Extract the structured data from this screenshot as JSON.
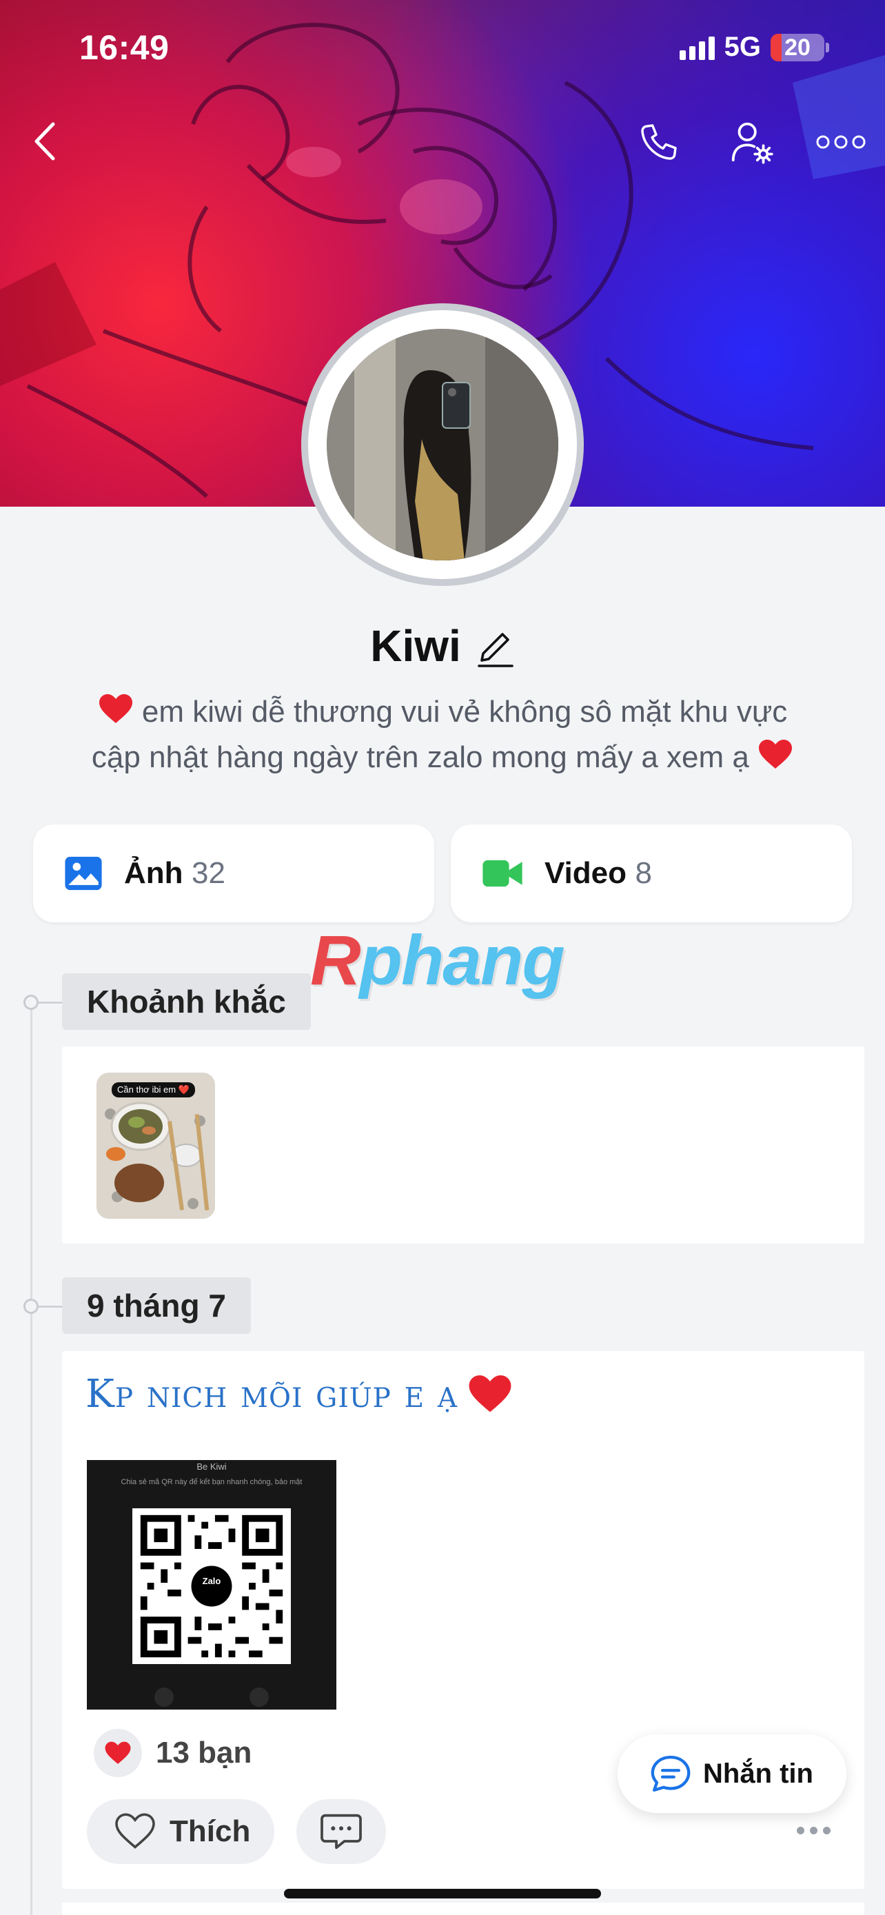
{
  "status_bar": {
    "time": "16:49",
    "network": "5G",
    "battery": "20",
    "battery_level_percent": 20
  },
  "nav": {
    "back_icon": "chevron-left-icon",
    "call_icon": "phone-icon",
    "settings_icon": "user-settings-icon",
    "more_icon": "more-horizontal-icon"
  },
  "profile": {
    "name": "Kiwi",
    "edit_icon": "pencil-icon",
    "bio_line1": "em kiwi dễ thương vui vẻ không sô mặt khu vực",
    "bio_line2": "cập nhật hàng ngày trên zalo mong mấy a xem ạ"
  },
  "media": {
    "photos_label": "Ảnh",
    "photos_count": "32",
    "videos_label": "Video",
    "videos_count": "8"
  },
  "watermark": {
    "r": "R",
    "rest": "phang"
  },
  "moments": {
    "label": "Khoảnh khắc",
    "thumb_caption": "Cần thơ ibi em ❤️"
  },
  "post": {
    "date_label": "9 tháng 7",
    "text": "Kp nich mõi giúp e ạ",
    "qr_title": "Be Kiwi",
    "qr_subtitle": "Chia sẻ mã QR này để kết bạn nhanh chóng, bảo mật",
    "qr_logo_text": "Zalo",
    "reaction_count": "13 bạn",
    "like_label": "Thích"
  },
  "message_button": {
    "label": "Nhắn tin"
  },
  "colors": {
    "accent_blue": "#1a73e8",
    "video_green": "#34c55a",
    "heart_red": "#e8232f",
    "background": "#f3f4f6"
  }
}
